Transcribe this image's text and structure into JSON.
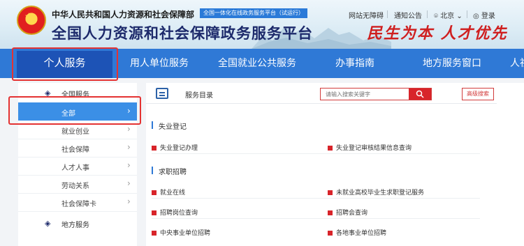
{
  "header": {
    "ministry": "中华人民共和国人力资源和社会保障部",
    "beta_badge": "全国一体化在线政务服务平台（试运行）",
    "platform_title": "全国人力资源和社会保障政务服务平台",
    "slogan": "民生为本 人才优先",
    "links": {
      "accessibility": "网站无障碍",
      "notice": "通知公告",
      "location": "北京",
      "login": "登录"
    }
  },
  "nav": {
    "items": [
      "个人服务",
      "用人单位服务",
      "全国就业公共服务",
      "办事指南",
      "地方服务窗口",
      "人社"
    ]
  },
  "sidebar": {
    "national_header": "全国服务",
    "items": [
      "全部",
      "就业创业",
      "社会保障",
      "人才人事",
      "劳动关系",
      "社会保障卡"
    ],
    "local_header": "地方服务"
  },
  "catalog": {
    "title": "服务目录",
    "search_placeholder": "请输入搜索关键字",
    "advanced_search": "高级搜索"
  },
  "sections": [
    {
      "title": "失业登记",
      "services": [
        "失业登记办理",
        "失业登记审核结果信息查询"
      ]
    },
    {
      "title": "求职招聘",
      "services": [
        "就业在线",
        "未就业高校毕业生求职登记服务",
        "招聘岗位查询",
        "招聘会查询",
        "中央事业单位招聘",
        "各地事业单位招聘"
      ]
    }
  ],
  "colors": {
    "nav_bg": "#2f79d6",
    "nav_active": "#1d53b6",
    "sidebar_active": "#3b8fe6",
    "accent_red": "#d8242a",
    "highlight_box": "#e43232"
  }
}
